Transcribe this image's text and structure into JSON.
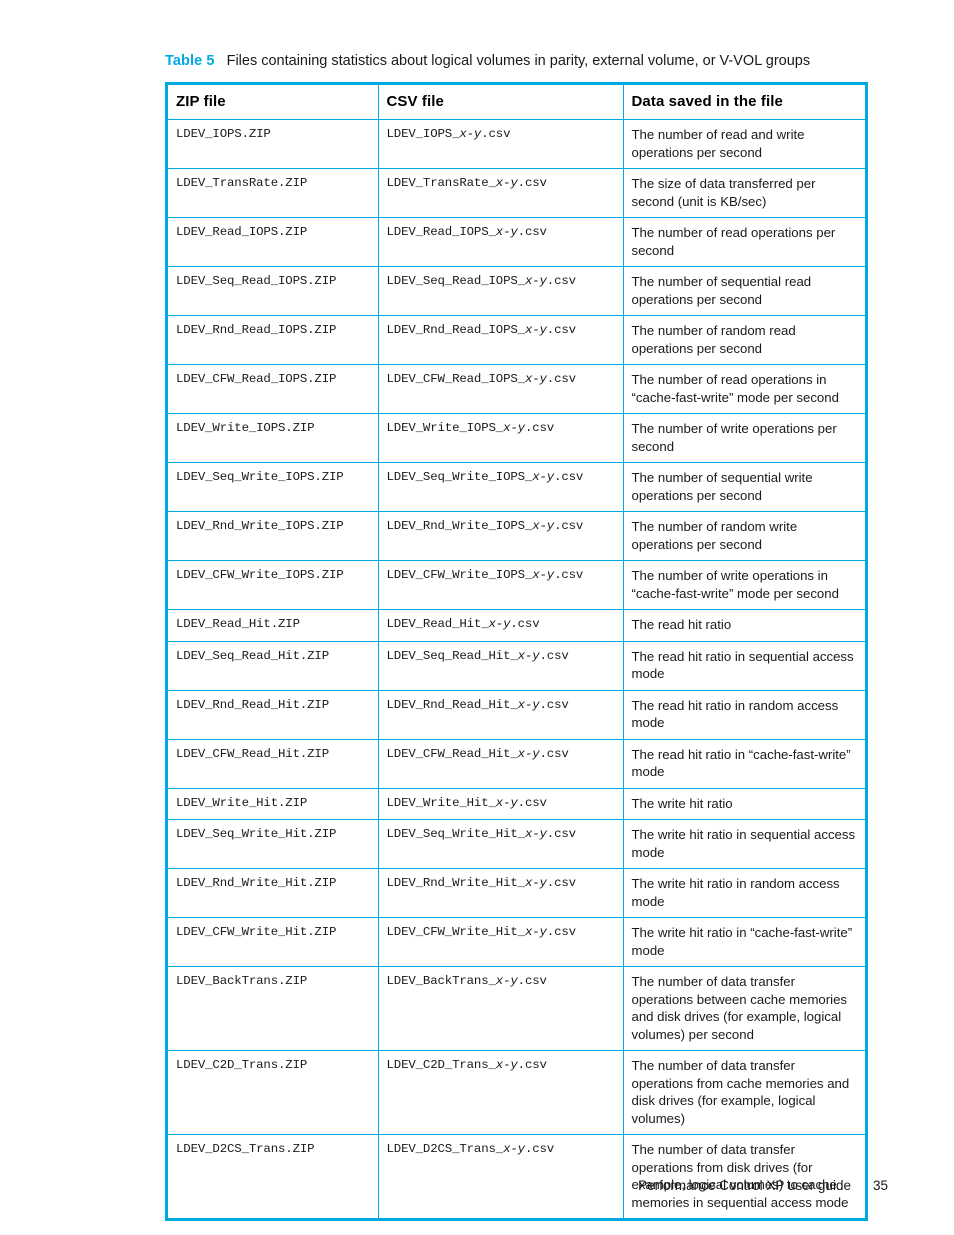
{
  "caption": {
    "label": "Table 5",
    "text": "Files containing statistics about logical volumes in parity, external volume, or V-VOL groups",
    "accent_color": "#00A9E0"
  },
  "table": {
    "border_color": "#00A9E0",
    "headers": [
      "ZIP file",
      "CSV file",
      "Data saved in the file"
    ],
    "rows": [
      {
        "zip": "LDEV_IOPS.ZIP",
        "csv_prefix": "LDEV_IOPS_",
        "csv_var": "x-y",
        "csv_suffix": ".csv",
        "desc": "The number of read and write operations per second"
      },
      {
        "zip": "LDEV_TransRate.ZIP",
        "csv_prefix": "LDEV_TransRate_",
        "csv_var": "x-y",
        "csv_suffix": ".csv",
        "desc": "The size of data transferred per second (unit is KB/sec)"
      },
      {
        "zip": "LDEV_Read_IOPS.ZIP",
        "csv_prefix": "LDEV_Read_IOPS_",
        "csv_var": "x-y",
        "csv_suffix": ".csv",
        "desc": "The number of read operations per second"
      },
      {
        "zip": "LDEV_Seq_Read_IOPS.ZIP",
        "csv_prefix": "LDEV_Seq_Read_IOPS_",
        "csv_var": "x-y",
        "csv_suffix": ".csv",
        "desc": "The number of sequential read operations per second"
      },
      {
        "zip": "LDEV_Rnd_Read_IOPS.ZIP",
        "csv_prefix": "LDEV_Rnd_Read_IOPS_",
        "csv_var": "x-y",
        "csv_suffix": ".csv",
        "desc": "The number of random read operations per second"
      },
      {
        "zip": "LDEV_CFW_Read_IOPS.ZIP",
        "csv_prefix": "LDEV_CFW_Read_IOPS_",
        "csv_var": "x-y",
        "csv_suffix": ".csv",
        "desc": "The number of read operations in “cache-fast-write” mode per second"
      },
      {
        "zip": "LDEV_Write_IOPS.ZIP",
        "csv_prefix": "LDEV_Write_IOPS_",
        "csv_var": "x-y",
        "csv_suffix": ".csv",
        "desc": "The number of write operations per second"
      },
      {
        "zip": "LDEV_Seq_Write_IOPS.ZIP",
        "csv_prefix": "LDEV_Seq_Write_IOPS_",
        "csv_var": "x-y",
        "csv_suffix": ".csv",
        "desc": "The number of sequential write operations per second"
      },
      {
        "zip": "LDEV_Rnd_Write_IOPS.ZIP",
        "csv_prefix": "LDEV_Rnd_Write_IOPS_",
        "csv_var": "x-y",
        "csv_suffix": ".csv",
        "desc": "The number of random write operations per second"
      },
      {
        "zip": "LDEV_CFW_Write_IOPS.ZIP",
        "csv_prefix": "LDEV_CFW_Write_IOPS_",
        "csv_var": "x-y",
        "csv_suffix": ".csv",
        "desc": "The number of write operations in “cache-fast-write” mode per second"
      },
      {
        "zip": "LDEV_Read_Hit.ZIP",
        "csv_prefix": "LDEV_Read_Hit_",
        "csv_var": "x-y",
        "csv_suffix": ".csv",
        "desc": "The read hit ratio"
      },
      {
        "zip": "LDEV_Seq_Read_Hit.ZIP",
        "csv_prefix": "LDEV_Seq_Read_Hit_",
        "csv_var": "x-y",
        "csv_suffix": ".csv",
        "desc": "The read hit ratio in sequential access mode"
      },
      {
        "zip": "LDEV_Rnd_Read_Hit.ZIP",
        "csv_prefix": "LDEV_Rnd_Read_Hit_",
        "csv_var": "x-y",
        "csv_suffix": ".csv",
        "desc": "The read hit ratio in random access mode"
      },
      {
        "zip": "LDEV_CFW_Read_Hit.ZIP",
        "csv_prefix": "LDEV_CFW_Read_Hit_",
        "csv_var": "x-y",
        "csv_suffix": ".csv",
        "desc": "The read hit ratio in “cache-fast-write” mode"
      },
      {
        "zip": "LDEV_Write_Hit.ZIP",
        "csv_prefix": "LDEV_Write_Hit_",
        "csv_var": "x-y",
        "csv_suffix": ".csv",
        "desc": "The write hit ratio"
      },
      {
        "zip": "LDEV_Seq_Write_Hit.ZIP",
        "csv_prefix": "LDEV_Seq_Write_Hit_",
        "csv_var": "x-y",
        "csv_suffix": ".csv",
        "desc": "The write hit ratio in sequential access mode"
      },
      {
        "zip": "LDEV_Rnd_Write_Hit.ZIP",
        "csv_prefix": "LDEV_Rnd_Write_Hit_",
        "csv_var": "x-y",
        "csv_suffix": ".csv",
        "desc": "The write hit ratio in random access mode"
      },
      {
        "zip": "LDEV_CFW_Write_Hit.ZIP",
        "csv_prefix": "LDEV_CFW_Write_Hit_",
        "csv_var": "x-y",
        "csv_suffix": ".csv",
        "desc": "The write hit ratio in “cache-fast-write” mode"
      },
      {
        "zip": "LDEV_BackTrans.ZIP",
        "csv_prefix": "LDEV_BackTrans_",
        "csv_var": "x-y",
        "csv_suffix": ".csv",
        "desc": "The number of data transfer operations between cache memories and disk drives (for example, logical volumes) per second"
      },
      {
        "zip": "LDEV_C2D_Trans.ZIP",
        "csv_prefix": "LDEV_C2D_Trans_",
        "csv_var": "x-y",
        "csv_suffix": ".csv",
        "desc": "The number of data transfer operations from cache memories and disk drives (for example, logical volumes)"
      },
      {
        "zip": "LDEV_D2CS_Trans.ZIP",
        "csv_prefix": "LDEV_D2CS_Trans_",
        "csv_var": "x-y",
        "csv_suffix": ".csv",
        "desc": "The number of data transfer operations from disk drives (for example, logical volumes) to cache memories in sequential access mode"
      }
    ]
  },
  "footer": {
    "guide_title": "Performance Control XP user guide",
    "page_number": "35"
  }
}
